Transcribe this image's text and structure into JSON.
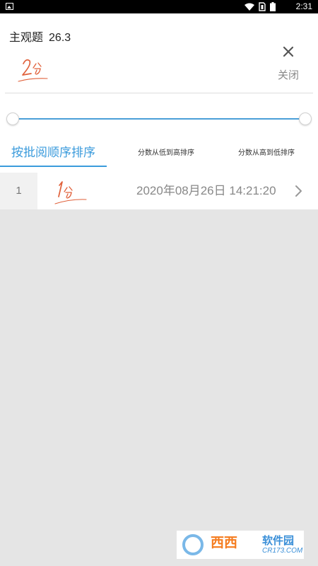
{
  "status_bar": {
    "time": "2:31",
    "icons": [
      "image-notification-icon",
      "wifi-icon",
      "sim-icon",
      "battery-icon"
    ]
  },
  "header": {
    "title": "主观题",
    "score": "26.3",
    "handwritten_score": "2分",
    "close_label": "关闭",
    "close_icon": "close-icon"
  },
  "range_slider": {
    "min_fraction": 0.0,
    "max_fraction": 1.0,
    "accent_color": "#4a9fd8"
  },
  "tabs": [
    {
      "label": "按批阅顺序排序",
      "active": true
    },
    {
      "label": "分数从低到高排序",
      "active": false
    },
    {
      "label": "分数从高到低排序",
      "active": false
    }
  ],
  "records": [
    {
      "index": "1",
      "handwritten_score": "1分",
      "timestamp": "2020年08月26日 14:21:20"
    }
  ],
  "watermark": {
    "main": "西西",
    "sub": "软件园",
    "domain": "CR173.COM"
  },
  "colors": {
    "accent": "#3b9bdc",
    "handwriting": "#e0603a",
    "background": "#e5e5e5"
  }
}
